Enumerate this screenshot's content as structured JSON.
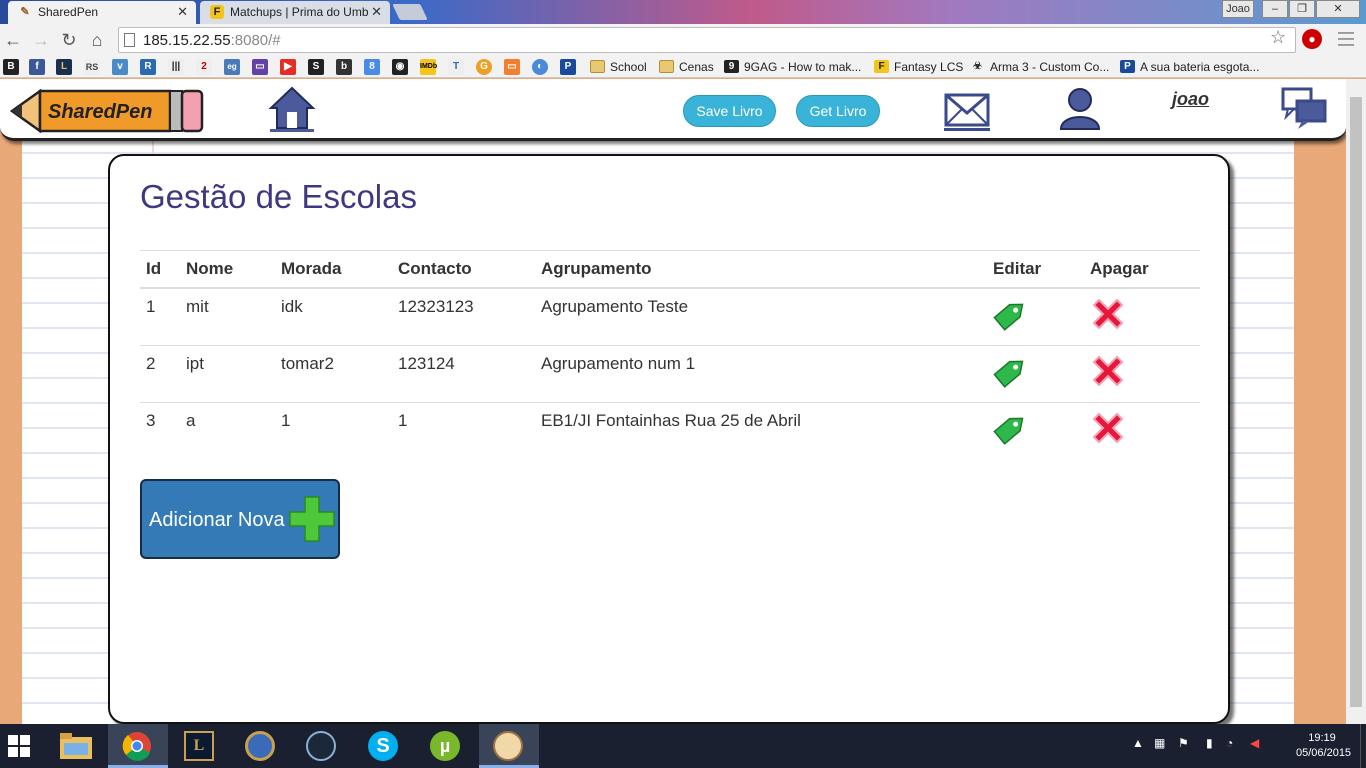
{
  "browser": {
    "tabs": [
      {
        "title": "SharedPen",
        "active": true
      },
      {
        "title": "Matchups | Prima do Umb",
        "active": false
      }
    ],
    "window_user": "Joao",
    "url_host": "185.15.22.55",
    "url_rest": ":8080/#",
    "bookmarks": [
      {
        "label": "School",
        "type": "folder"
      },
      {
        "label": "Cenas",
        "type": "folder"
      },
      {
        "label": "9GAG - How to mak...",
        "type": "link"
      },
      {
        "label": "Fantasy LCS",
        "type": "link"
      },
      {
        "label": "Arma 3 - Custom Co...",
        "type": "link"
      },
      {
        "label": "A sua bateria esgota...",
        "type": "link"
      }
    ],
    "bookmark_icons": [
      "B",
      "f",
      "L",
      "RS",
      "v",
      "R",
      "I",
      "2",
      "eg",
      "tw",
      "yt",
      "S",
      "b",
      "8",
      "o",
      "IMDb",
      "T",
      "G",
      "b",
      "o",
      "P"
    ]
  },
  "app": {
    "logo": "SharedPen",
    "save_button": "Save Livro",
    "get_button": "Get Livro",
    "username": "joao"
  },
  "page": {
    "title": "Gestão de Escolas",
    "columns": [
      "Id",
      "Nome",
      "Morada",
      "Contacto",
      "Agrupamento",
      "Editar",
      "Apagar"
    ],
    "rows": [
      {
        "id": "1",
        "nome": "mit",
        "morada": "idk",
        "contacto": "12323123",
        "agrupamento": "Agrupamento Teste"
      },
      {
        "id": "2",
        "nome": "ipt",
        "morada": "tomar2",
        "contacto": "123124",
        "agrupamento": "Agrupamento num 1"
      },
      {
        "id": "3",
        "nome": "a",
        "morada": "1",
        "contacto": "1",
        "agrupamento": "EB1/JI Fontainhas Rua 25 de Abril"
      }
    ],
    "add_button": "Adicionar Nova"
  },
  "taskbar": {
    "time": "19:19",
    "date": "05/06/2015"
  },
  "colors": {
    "title": "#3e3880",
    "pill": "#39b3d7",
    "add_button": "#337ab7",
    "edit_icon": "#2fb84a",
    "delete_icon": "#e8163a"
  }
}
